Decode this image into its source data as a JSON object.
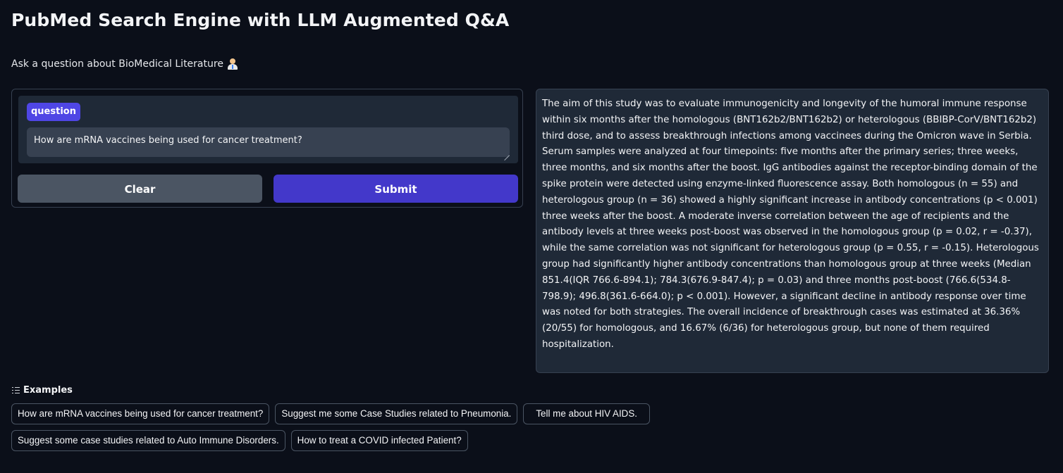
{
  "header": {
    "title": "PubMed Search Engine with LLM Augmented Q&A",
    "subtitle": "Ask a question about BioMedical Literature",
    "subtitle_icon": "doctor-emoji-icon"
  },
  "input": {
    "label": "question",
    "value": "How are mRNA vaccines being used for cancer treatment?",
    "clear_label": "Clear",
    "submit_label": "Submit"
  },
  "output": {
    "text": "The aim of this study was to evaluate immunogenicity and longevity of the humoral immune response within six months after the homologous (BNT162b2/BNT162b2) or heterologous (BBIBP-CorV/BNT162b2) third dose, and to assess breakthrough infections among vaccinees during the Omicron wave in Serbia. Serum samples were analyzed at four timepoints: five months after the primary series; three weeks, three months, and six months after the boost. IgG antibodies against the receptor-binding domain of the spike protein were detected using enzyme-linked fluorescence assay. Both homologous (n = 55) and heterologous group (n = 36) showed a highly significant increase in antibody concentrations (p < 0.001) three weeks after the boost. A moderate inverse correlation between the age of recipients and the antibody levels at three weeks post-boost was observed in the homologous group (p = 0.02, r = -0.37), while the same correlation was not significant for heterologous group (p = 0.55, r = -0.15). Heterologous group had significantly higher antibody concentrations than homologous group at three weeks (Median 851.4(IQR 766.6-894.1); 784.3(676.9-847.4); p = 0.03) and three months post-boost (766.6(534.8-798.9); 496.8(361.6-664.0); p < 0.001). However, a significant decline in antibody response over time was noted for both strategies. The overall incidence of breakthrough cases was estimated at 36.36% (20/55) for homologous, and 16.67% (6/36) for heterologous group, but none of them required hospitalization."
  },
  "examples": {
    "header": "Examples",
    "items": [
      "How are mRNA vaccines being used for cancer treatment?",
      "Suggest me some Case Studies related to Pneumonia.",
      "Tell me about HIV AIDS.",
      "Suggest some case studies related to Auto Immune Disorders.",
      "How to treat a COVID infected Patient?"
    ]
  },
  "colors": {
    "background": "#0b0f19",
    "panel": "#1f2937",
    "accent": "#4338ca",
    "label": "#4f46e5",
    "secondary_button": "#4b5563"
  }
}
